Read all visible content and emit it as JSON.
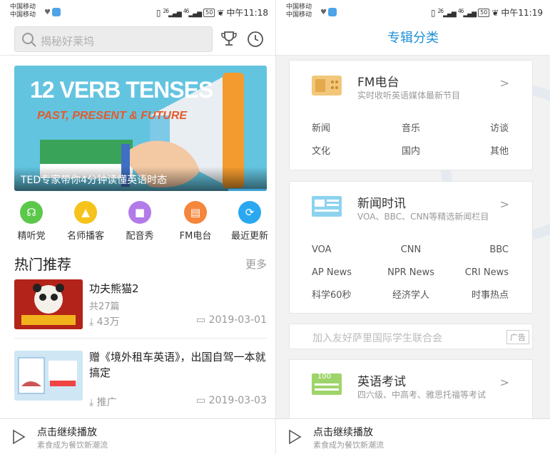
{
  "left": {
    "status": {
      "carrier_1": "中国移动",
      "carrier_2": "中国移动",
      "network": "26",
      "network2": "46",
      "battery": "50",
      "time": "中午11:18"
    },
    "search": {
      "placeholder": "揭秘好莱坞"
    },
    "banner": {
      "headline": "12 VERB TENSES",
      "subhead": "PAST, PRESENT & FUTURE",
      "caption": "TED专家带你4分钟读懂英语时态"
    },
    "menu": [
      {
        "label": "精听党",
        "icon": "headphones-icon",
        "color": "#5cc84b"
      },
      {
        "label": "名师播客",
        "icon": "graduation-cap-icon",
        "color": "#f5c31b"
      },
      {
        "label": "配音秀",
        "icon": "video-camera-icon",
        "color": "#b37be8"
      },
      {
        "label": "FM电台",
        "icon": "radio-icon",
        "color": "#f5863b"
      },
      {
        "label": "最近更新",
        "icon": "refresh-icon",
        "color": "#29a8f0"
      }
    ],
    "hot": {
      "title": "热门推荐",
      "more": "更多",
      "items": [
        {
          "title": "功夫熊猫2",
          "count": "共27篇",
          "plays": "43万",
          "date": "2019-03-01",
          "thumb_text": "KUNG FU PANDA"
        },
        {
          "title": "赠《境外租车英语》，出国自驾一本就搞定",
          "tag": "推广",
          "date": "2019-03-03",
          "thumb_text": "Economy car 经济型车"
        }
      ]
    },
    "player": {
      "title": "点击继续播放",
      "subtitle": "素食成为餐饮新潮流"
    }
  },
  "right": {
    "status": {
      "carrier_1": "中国移动",
      "carrier_2": "中国移动",
      "network": "26",
      "network2": "46",
      "battery": "50",
      "time": "中午11:19"
    },
    "header": {
      "title": "专辑分类"
    },
    "categories": [
      {
        "name": "FM电台",
        "desc": "实时收听英语媒体最新节目",
        "icon": "radio-icon",
        "rows": [
          [
            "新闻",
            "音乐",
            "访谈"
          ],
          [
            "文化",
            "国内",
            "其他"
          ]
        ]
      },
      {
        "name": "新闻时讯",
        "desc": "VOA、BBC、CNN等精选新闻栏目",
        "icon": "newspaper-icon",
        "rows": [
          [
            "VOA",
            "CNN",
            "BBC"
          ],
          [
            "AP News",
            "NPR News",
            "CRI News"
          ],
          [
            "科学60秒",
            "经济学人",
            "时事热点"
          ]
        ]
      },
      {
        "name": "英语考试",
        "desc": "四六级、中高考、雅思托福等考试",
        "icon": "exam-paper-icon",
        "icon_text": "100",
        "rows": []
      }
    ],
    "ad": {
      "text": "加入友好萨里国际学生联合会",
      "tag": "广告"
    },
    "player": {
      "title": "点击继续播放",
      "subtitle": "素食成为餐饮新潮流"
    }
  },
  "colors": {
    "accent": "#1e8fd6"
  }
}
